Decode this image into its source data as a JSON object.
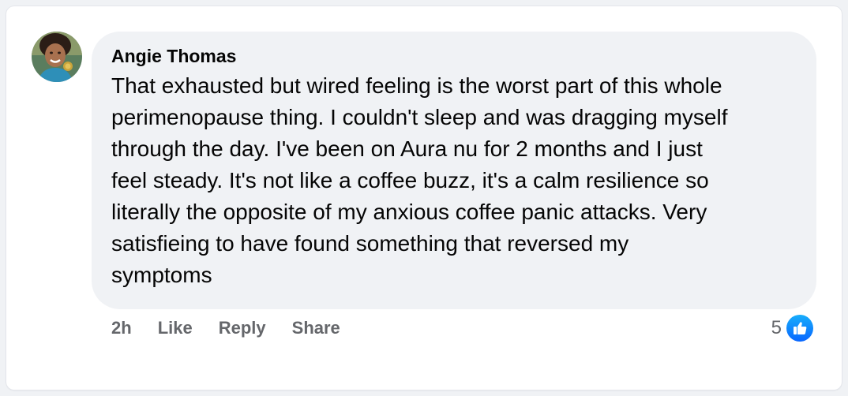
{
  "comment": {
    "author": "Angie Thomas",
    "lines": [
      "That exhausted but wired feeling is the worst part of this whole",
      "perimenopause thing. I couldn't sleep and was dragging myself",
      "through the day. I've been on Aura nu for 2 months and I just",
      "feel steady. It's not like a coffee buzz, it's a calm resilience so",
      "literally the opposite of my anxious coffee panic attacks. Very",
      "satisfieing to have found something that reversed my",
      "symptoms"
    ],
    "timestamp": "2h",
    "actions": {
      "like": "Like",
      "reply": "Reply",
      "share": "Share"
    },
    "reactions": {
      "count": "5",
      "icon": "thumbs-up-icon",
      "color": "#0866ff"
    }
  },
  "theme": {
    "bubble_bg": "#f0f2f5",
    "text": "#050505",
    "muted": "#65676b"
  }
}
